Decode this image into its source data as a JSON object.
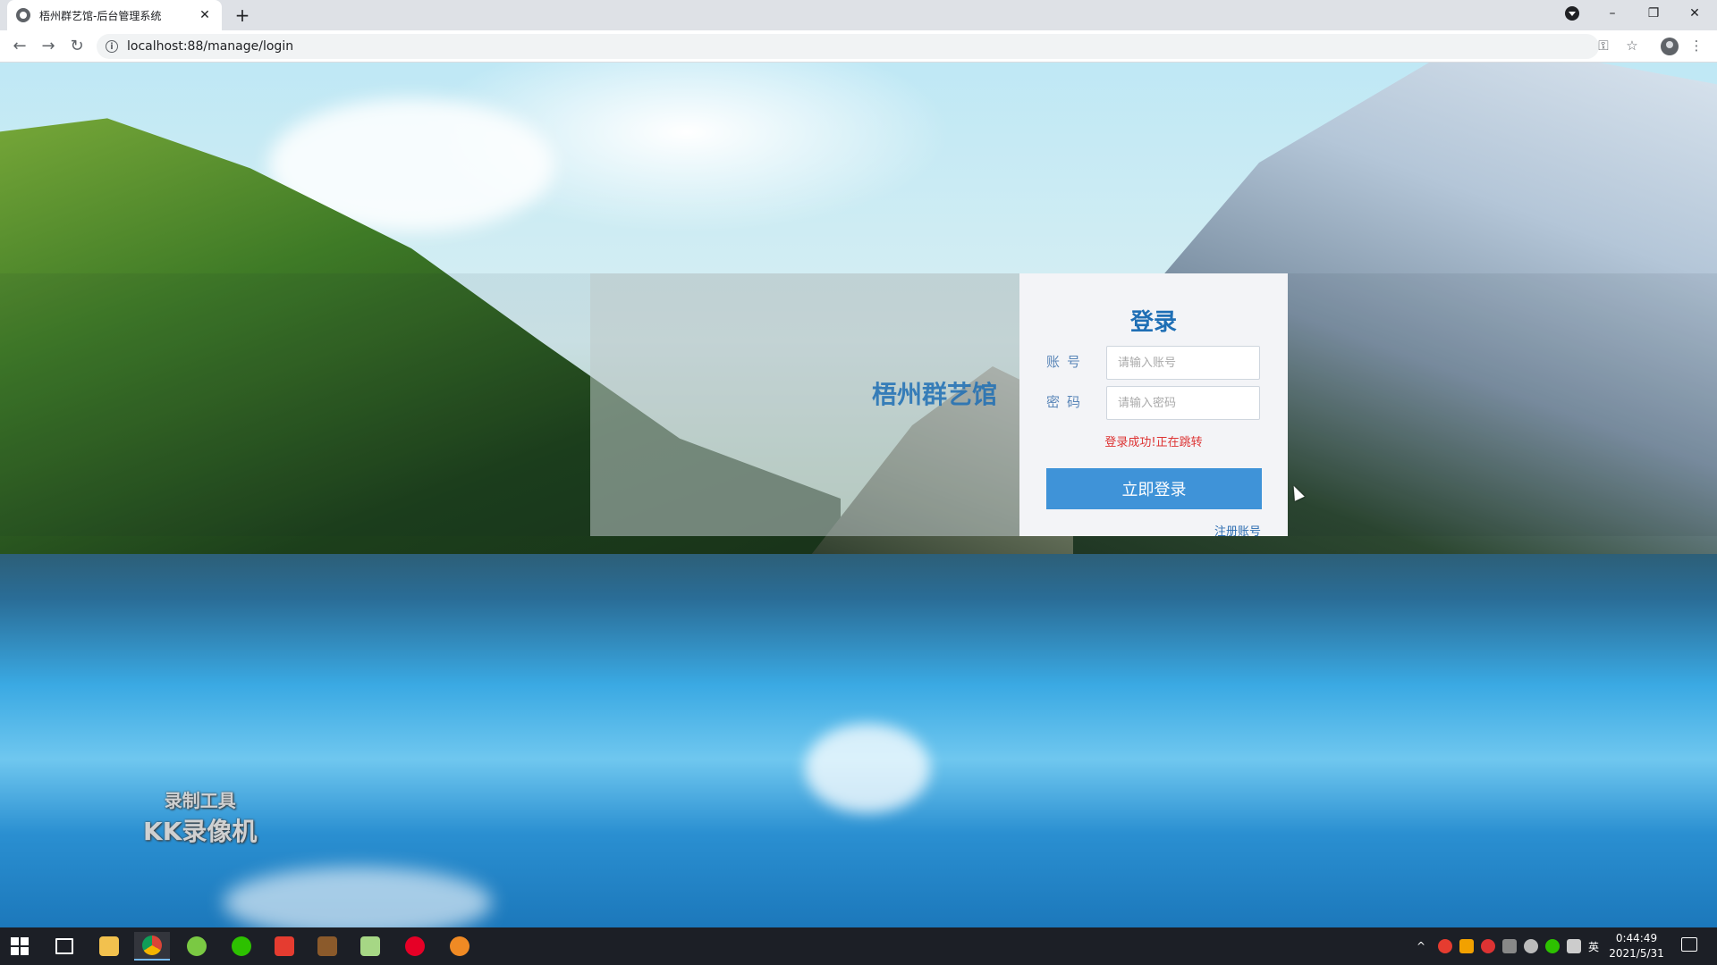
{
  "browser": {
    "tab_title": "梧州群艺馆-后台管理系统",
    "tab_close": "✕",
    "new_tab": "+",
    "url": "localhost:88/manage/login",
    "back": "←",
    "forward": "→",
    "reload": "↻",
    "info": "i",
    "key_icon": "⚿",
    "star_icon": "☆",
    "menu_icon": "⋮",
    "minimize": "–",
    "restore": "❐",
    "close": "✕"
  },
  "page": {
    "brand_text": "梧州群艺馆"
  },
  "login": {
    "title": "登录",
    "account_label": "账号",
    "account_placeholder": "请输入账号",
    "password_label": "密码",
    "password_placeholder": "请输入密码",
    "status_message": "登录成功!正在跳转",
    "submit_label": "立即登录",
    "register_label": "注册账号"
  },
  "watermark": {
    "line1": "录制工具",
    "line2": "KK录像机"
  },
  "taskbar": {
    "time": "0:44:49",
    "date": "2021/5/31",
    "ime": "英",
    "tray_up": "^"
  },
  "colors": {
    "accent": "#3f93d8",
    "title_blue": "#1f6fb5",
    "status_red": "#dd3333"
  }
}
